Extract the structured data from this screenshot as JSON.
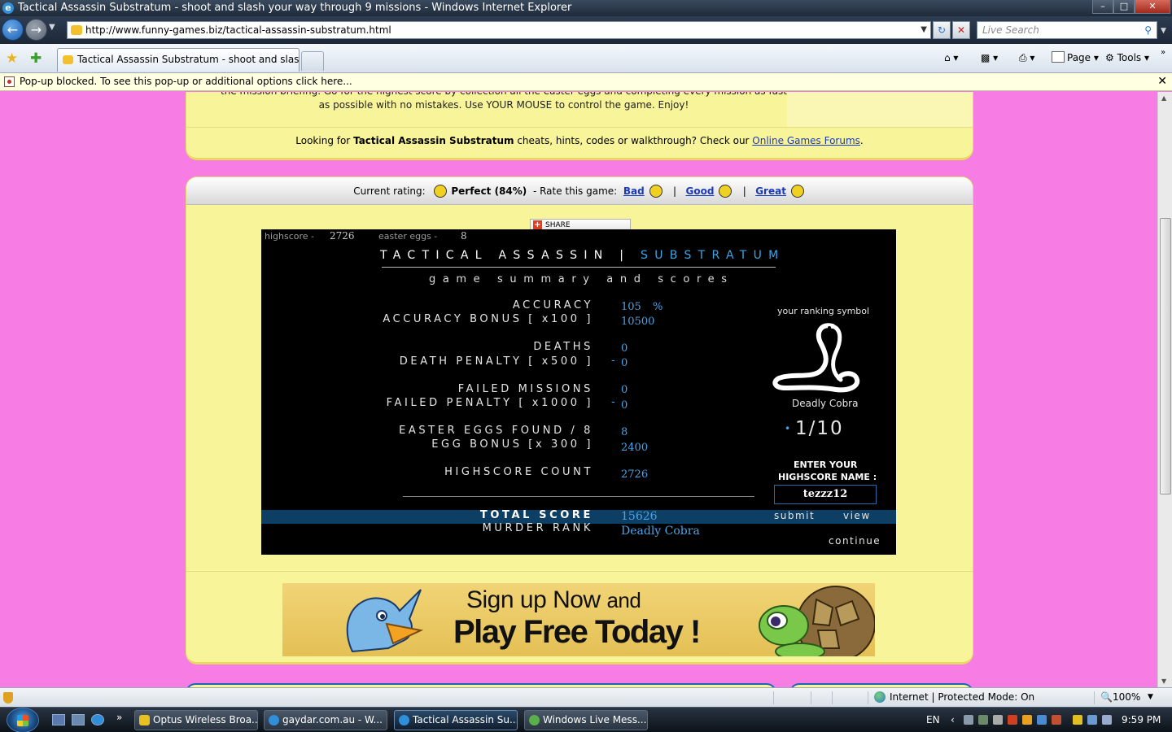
{
  "window": {
    "title": "Tactical Assassin Substratum - shoot and slash your way through 9 missions - Windows Internet Explorer",
    "min_label": "–",
    "max_label": "□",
    "close_label": "✕"
  },
  "toolbar": {
    "url": "http://www.funny-games.biz/tactical-assassin-substratum.html",
    "search_placeholder": "Live Search",
    "tab_title": "Tactical Assassin Substratum - shoot and slash y...",
    "page_label": "Page",
    "tools_label": "Tools"
  },
  "popup": {
    "message": "Pop-up blocked. To see this pop-up or additional options click here..."
  },
  "page": {
    "description_line1": "the mission briefing. Go for the highest score by collection all the easter eggs and completing every mission as fast",
    "description_line2": "as possible with no mistakes. Use YOUR MOUSE to control the game. Enjoy!",
    "cheats_prefix": "Looking for ",
    "cheats_game": "Tactical Assassin Substratum",
    "cheats_mid": " cheats, hints, codes or walkthrough? Check our ",
    "cheats_link": "Online Games Forums",
    "cheats_end": ".",
    "rating": {
      "current_label": "Current rating:",
      "current_value": "Perfect (84%)",
      "rate_label": "-  Rate this game:",
      "bad": "Bad",
      "good": "Good",
      "great": "Great",
      "sep": "|"
    },
    "share_label": "SHARE"
  },
  "game": {
    "hud_highscore_label": "highscore -",
    "hud_highscore_value": "2726",
    "hud_eggs_label": "easter eggs -",
    "hud_eggs_value": "8",
    "title_white": "TACTICAL ASSASSIN | ",
    "title_blue": "SUBSTRATUM",
    "subtitle": "game summary and scores",
    "rows": {
      "accuracy_label": "ACCURACY",
      "accuracy_value": "105",
      "accuracy_unit": "%",
      "accuracy_bonus_label": "ACCURACY BONUS [ x100 ]",
      "accuracy_bonus_value": "10500",
      "deaths_label": "DEATHS",
      "deaths_value": "0",
      "death_penalty_label": "DEATH PENALTY [ x500 ]",
      "death_penalty_value": "0",
      "failed_missions_label": "FAILED MISSIONS",
      "failed_missions_value": "0",
      "failed_penalty_label": "FAILED PENALTY [ x1000 ]",
      "failed_penalty_value": "0",
      "eggs_label": "EASTER EGGS FOUND / 8",
      "eggs_value": "8",
      "egg_bonus_label": "EGG BONUS [x 300 ]",
      "egg_bonus_value": "2400",
      "highscore_count_label": "HIGHSCORE COUNT",
      "highscore_count_value": "2726",
      "total_label": "TOTAL SCORE",
      "total_value": "15626",
      "rank_label": "MURDER RANK",
      "rank_value": "Deadly Cobra",
      "minus": "-"
    },
    "ranking": {
      "heading": "your ranking symbol",
      "symbol_name": "Deadly Cobra",
      "rank": "1/10",
      "enter_line1": "ENTER YOUR",
      "enter_line2": "HIGHSCORE NAME :",
      "name_value": "tezzz12",
      "submit": "submit",
      "view": "view",
      "continue": "continue"
    }
  },
  "banner": {
    "line1_a": "Sign up Now",
    "line1_b": "and",
    "line2": "Play Free Today !"
  },
  "status": {
    "zone": "Internet | Protected Mode: On",
    "zoom": "100%"
  },
  "taskbar": {
    "tasks": [
      {
        "label": "Optus Wireless Broa..."
      },
      {
        "label": "gaydar.com.au - W..."
      },
      {
        "label": "Tactical Assassin Su..."
      },
      {
        "label": "Windows Live Mess..."
      }
    ],
    "lang": "EN",
    "time": "9:59 PM",
    "more": "»"
  },
  "colors": {
    "page_bg": "#f77ce3",
    "panel_bg": "#f8f49a",
    "game_blue": "#4aa4e8",
    "link": "#1a3ab8"
  }
}
